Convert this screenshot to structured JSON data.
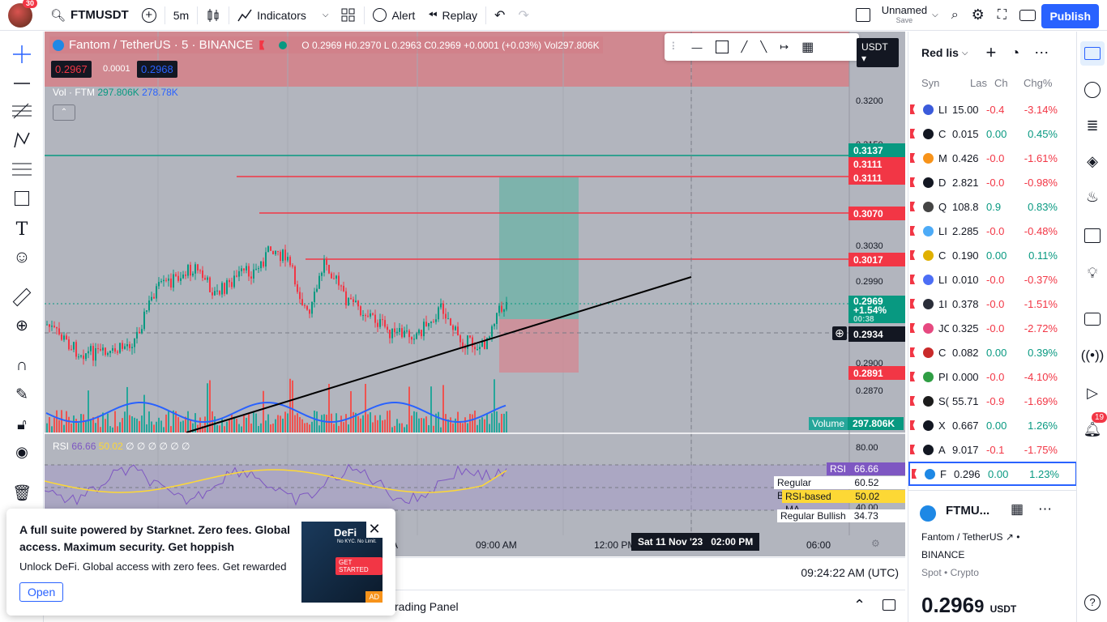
{
  "toolbar": {
    "notification_count": "30",
    "symbol": "FTMUSDT",
    "interval": "5m",
    "indicators_label": "Indicators",
    "alert_label": "Alert",
    "replay_label": "Replay",
    "layout_name": "Unnamed",
    "layout_save": "Save",
    "publish_label": "Publish"
  },
  "chart": {
    "title": "Fantom / TetherUS · 5 · BINANCE",
    "ohlc_o_label": "O",
    "ohlc_o": "0.2969",
    "ohlc_h_label": "H",
    "ohlc_h": "0.2970",
    "ohlc_l_label": "L",
    "ohlc_l": "0.2963",
    "ohlc_c_label": "C",
    "ohlc_c": "0.2969",
    "ohlc_change": "+0.0001 (+0.03%)",
    "vol_label": "Vol",
    "vol_value": "297.806K",
    "sell_price": "0.2967",
    "spread": "0.0001",
    "buy_price": "0.2968",
    "vol_legend_label": "Vol · FTM",
    "vol_legend_v1": "297.806K",
    "vol_legend_v2": "278.78K",
    "currency_btn": "USDT",
    "price_labels": {
      "p3200": "0.3200",
      "p3150": "0.3150",
      "p3030": "0.3030",
      "p2990": "0.2990",
      "p2900": "0.2900",
      "p2870": "0.2870",
      "p2934": "0.2934"
    },
    "tags": {
      "t3137": "0.3137",
      "t3111a": "0.3111",
      "t3111b": "0.3111",
      "t3070": "0.3070",
      "t3017": "0.3017",
      "t2969": "0.2969",
      "t_pct": "+1.54%",
      "t_countdown": "00:38",
      "t2891": "0.2891"
    },
    "volume_label": "Volume",
    "volume_value": "297.806K",
    "rsi_legend": "RSI",
    "rsi_v1": "66.66",
    "rsi_v2": "50.02",
    "rsi_zeros": "∅ ∅ ∅ ∅ ∅ ∅",
    "rsi_scale_80": "80.00",
    "rsi_scale_40": "40.00",
    "rsi_tag_label": "RSI",
    "rsi_tag_value": "66.66",
    "reg_bearish_label": "Regular Bearish",
    "reg_bearish_value": "60.52",
    "rsi_ma_label": "RSI-based MA",
    "rsi_ma_value": "50.02",
    "reg_bullish_label": "Regular Bullish",
    "reg_bullish_value": "34.73",
    "time_a": "A",
    "time_0900": "09:00 AM",
    "time_1200": "12:00 PM",
    "crosshair_time": "Sat 11 Nov '23",
    "crosshair_time_b": "02:00 PM",
    "time_0600": "06:00",
    "clock": "09:24:22 AM (UTC)"
  },
  "trading_panel": {
    "label": "rading Panel"
  },
  "popup": {
    "title": "A full suite powered by Starknet. Zero fees. Global access. Maximum security. Get hoppish",
    "body": "Unlock DeFi. Global access with zero fees. Get rewarded",
    "open_label": "Open",
    "ad_text_1": "DeFi",
    "ad_text_2": "No KYC. No Limit.",
    "ad_cta": "GET STARTED",
    "ad_badge": "AD"
  },
  "watchlist": {
    "title": "Red lis",
    "col_symbol": "Syn",
    "col_last": "Las",
    "col_chg": "Ch",
    "col_chgpct": "Chg%",
    "rows": [
      {
        "sym": "LI",
        "last": "15.00",
        "chg": "-0.4",
        "pct": "-3.14%",
        "dir": "red",
        "coin": "#3b5bdb"
      },
      {
        "sym": "C",
        "last": "0.015",
        "chg": "0.00",
        "pct": "0.45%",
        "dir": "grn",
        "coin": "#131722"
      },
      {
        "sym": "M",
        "last": "0.426",
        "chg": "-0.0",
        "pct": "-1.61%",
        "dir": "red",
        "coin": "#f7931a"
      },
      {
        "sym": "D",
        "last": "2.821",
        "chg": "-0.0",
        "pct": "-0.98%",
        "dir": "red",
        "coin": "#131722"
      },
      {
        "sym": "Q",
        "last": "108.8",
        "chg": "0.9",
        "pct": "0.83%",
        "dir": "grn",
        "coin": "#444"
      },
      {
        "sym": "LI",
        "last": "2.285",
        "chg": "-0.0",
        "pct": "-0.48%",
        "dir": "red",
        "coin": "#4dabf7"
      },
      {
        "sym": "C",
        "last": "0.190",
        "chg": "0.00",
        "pct": "0.11%",
        "dir": "grn",
        "coin": "#e0b000"
      },
      {
        "sym": "LI",
        "last": "0.010",
        "chg": "-0.0",
        "pct": "-0.37%",
        "dir": "red",
        "coin": "#4c6ef5"
      },
      {
        "sym": "1I",
        "last": "0.378",
        "chg": "-0.0",
        "pct": "-1.51%",
        "dir": "red",
        "coin": "#2a2e39"
      },
      {
        "sym": "JC",
        "last": "0.325",
        "chg": "-0.0",
        "pct": "-2.72%",
        "dir": "red",
        "coin": "#e64980"
      },
      {
        "sym": "C",
        "last": "0.082",
        "chg": "0.00",
        "pct": "0.39%",
        "dir": "grn",
        "coin": "#c92a2a"
      },
      {
        "sym": "PI",
        "last": "0.000",
        "chg": "-0.0",
        "pct": "-4.10%",
        "dir": "red",
        "coin": "#2f9e44"
      },
      {
        "sym": "S(",
        "last": "55.71",
        "chg": "-0.9",
        "pct": "-1.69%",
        "dir": "red",
        "coin": "#1c1c1c"
      },
      {
        "sym": "X",
        "last": "0.667",
        "chg": "0.00",
        "pct": "1.26%",
        "dir": "grn",
        "coin": "#131722"
      },
      {
        "sym": "A",
        "last": "9.017",
        "chg": "-0.1",
        "pct": "-1.75%",
        "dir": "red",
        "coin": "#131722"
      },
      {
        "sym": "F",
        "last": "0.296",
        "chg": "0.00",
        "pct": "1.23%",
        "dir": "grn",
        "coin": "#1e88e5"
      }
    ],
    "detail_symbol": "FTMU...",
    "detail_name": "Fantom / TetherUS",
    "detail_exchange": "BINANCE",
    "detail_type_1": "Spot",
    "detail_type_2": "Crypto",
    "detail_price_main": "0.296",
    "detail_price_last": "9",
    "detail_currency": "USDT"
  },
  "right_sidebar": {
    "notif_count": "19"
  },
  "colors": {
    "accent": "#2962ff",
    "up": "#089981",
    "down": "#f23645",
    "rsi_line": "#7e57c2",
    "rsi_ma": "#fdd835"
  }
}
